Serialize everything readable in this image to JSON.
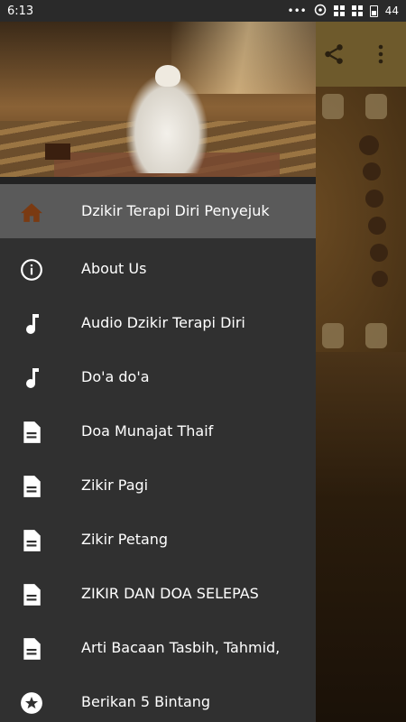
{
  "status_bar": {
    "time": "6:13",
    "dots": "•••",
    "battery_level": "44"
  },
  "colors": {
    "drawer_bg": "#303030",
    "active_item_bg": "#5a5a5a",
    "home_icon_color": "#7a3a12",
    "icon_color": "#ffffff",
    "toolbar_bg": "#6e5a2c"
  },
  "app_toolbar": {
    "share_icon": "share-icon",
    "overflow_icon": "more-vertical-icon"
  },
  "drawer": {
    "header_image": "man-praying-in-mosque",
    "items": [
      {
        "icon": "home-icon",
        "label": "Dzikir Terapi Diri Penyejuk",
        "active": true
      },
      {
        "icon": "info-icon",
        "label": "About Us",
        "active": false
      },
      {
        "icon": "music-note-icon",
        "label": "Audio Dzikir Terapi Diri",
        "active": false
      },
      {
        "icon": "music-note-icon",
        "label": "Do'a do'a",
        "active": false
      },
      {
        "icon": "document-icon",
        "label": "Doa Munajat Thaif",
        "active": false
      },
      {
        "icon": "document-icon",
        "label": "Zikir Pagi",
        "active": false
      },
      {
        "icon": "document-icon",
        "label": "Zikir Petang",
        "active": false
      },
      {
        "icon": "document-icon",
        "label": "ZIKIR DAN DOA SELEPAS",
        "active": false
      },
      {
        "icon": "document-icon",
        "label": "Arti Bacaan Tasbih, Tahmid,",
        "active": false
      },
      {
        "icon": "star-icon",
        "label": "Berikan 5 Bintang",
        "active": false
      }
    ]
  }
}
